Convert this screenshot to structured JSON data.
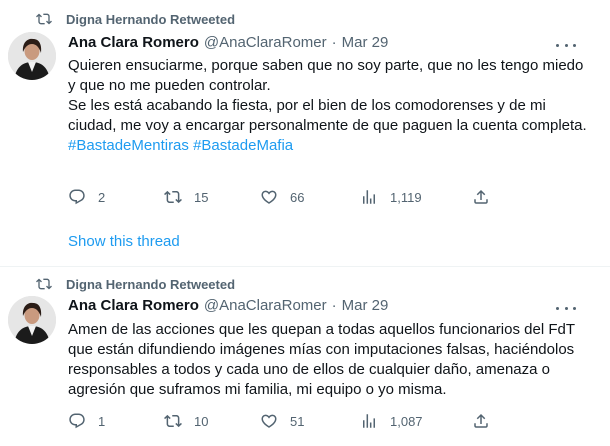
{
  "tweets": [
    {
      "retweeted_by": "Digna Hernando Retweeted",
      "author_name": "Ana Clara Romero",
      "author_handle": "@AnaClaraRomer",
      "separator": "·",
      "date": "Mar 29",
      "paragraphs": [
        "Quieren ensuciarme, porque saben que no soy parte, que no les tengo miedo y que no me pueden controlar.",
        "Se les está acabando la fiesta, por el bien de los comodorenses y de mi ciudad, me voy a encargar personalmente de que paguen la cuenta completa."
      ],
      "hashtags": [
        "#BastadeMentiras",
        "#BastadeMafia"
      ],
      "replies": "2",
      "retweets": "15",
      "likes": "66",
      "views": "1,119",
      "show_thread": "Show this thread"
    },
    {
      "retweeted_by": "Digna Hernando Retweeted",
      "author_name": "Ana Clara Romero",
      "author_handle": "@AnaClaraRomer",
      "separator": "·",
      "date": "Mar 29",
      "paragraphs": [
        "Amen de las acciones que les quepan a todas aquellos funcionarios del FdT que están difundiendo imágenes mías con imputaciones falsas, haciéndolos responsables a todos y cada uno de ellos de cualquier daño, amenaza o agresión que suframos mi familia, mi equipo o yo misma."
      ],
      "replies": "1",
      "retweets": "10",
      "likes": "51",
      "views": "1,087"
    }
  ],
  "icons": {
    "retweet": "retweet-icon",
    "reply": "reply-icon",
    "like": "heart-icon",
    "views": "views-bar-chart-icon",
    "share": "share-icon",
    "more": "more-dots-icon"
  },
  "colors": {
    "accent": "#1d9bf0",
    "secondary_text": "#536471",
    "primary_text": "#0f1419",
    "divider": "#eff3f4"
  }
}
